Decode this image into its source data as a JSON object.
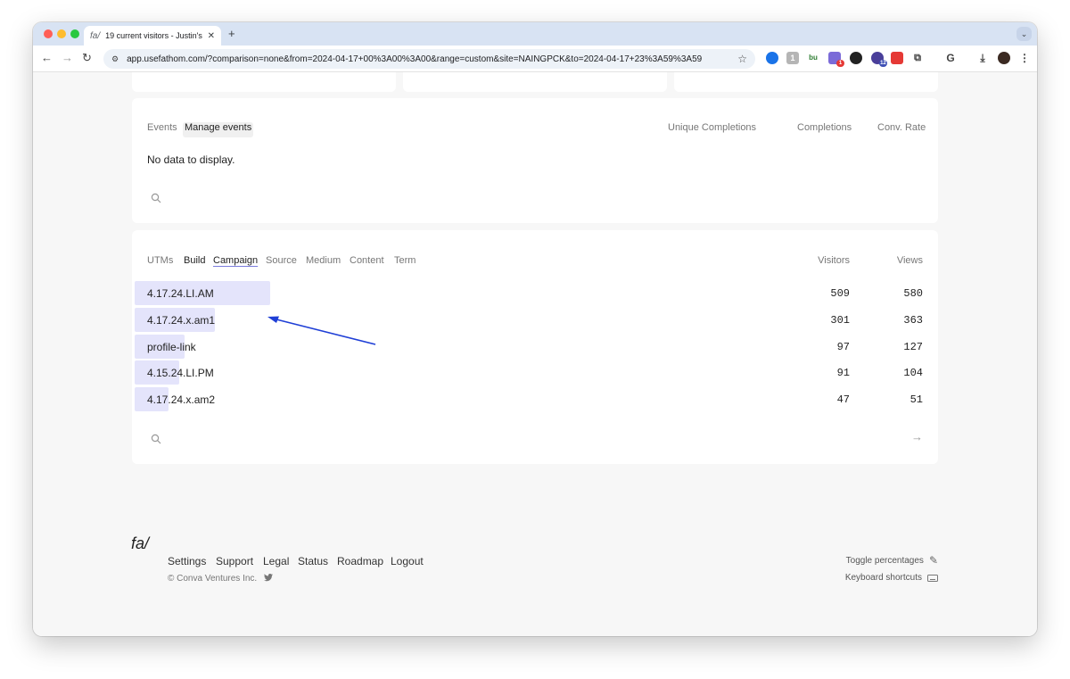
{
  "browser": {
    "tab_favicon": "fa/",
    "tab_title": "19 current visitors - Justin's",
    "new_tab_label": "+",
    "url": "app.usefathom.com/?comparison=none&from=2024-04-17+00%3A00%3A00&range=custom&site=NAINGPCK&to=2024-04-17+23%3A59%3A59",
    "extension_badges": [
      "1",
      "12"
    ]
  },
  "events_panel": {
    "tabs": [
      "Events",
      "Manage events"
    ],
    "columns": [
      "Unique Completions",
      "Completions",
      "Conv. Rate"
    ],
    "empty_message": "No data to display."
  },
  "utm_panel": {
    "tabs": [
      "UTMs",
      "Build",
      "Campaign",
      "Source",
      "Medium",
      "Content",
      "Term"
    ],
    "columns": [
      "Visitors",
      "Views"
    ],
    "rows": [
      {
        "label": "4.17.24.LI.AM",
        "visitors": "509",
        "views": "580",
        "share": 1.0
      },
      {
        "label": "4.17.24.x.am1",
        "visitors": "301",
        "views": "363",
        "share": 0.59
      },
      {
        "label": "profile-link",
        "visitors": "97",
        "views": "127",
        "share": 0.37
      },
      {
        "label": "4.15.24.LI.PM",
        "visitors": "91",
        "views": "104",
        "share": 0.33
      },
      {
        "label": "4.17.24.x.am2",
        "visitors": "47",
        "views": "51",
        "share": 0.25
      }
    ]
  },
  "annotation": {
    "color": "#1f3fd6"
  },
  "footer": {
    "logo": "fa/",
    "links": [
      "Settings",
      "Support",
      "Legal",
      "Status",
      "Roadmap",
      "Logout"
    ],
    "copyright": "© Conva Ventures Inc.",
    "toggle_percentages": "Toggle percentages",
    "keyboard_shortcuts": "Keyboard shortcuts"
  },
  "colors": {
    "bar": "#e4e4fb",
    "underline": "#7a7cdc"
  }
}
